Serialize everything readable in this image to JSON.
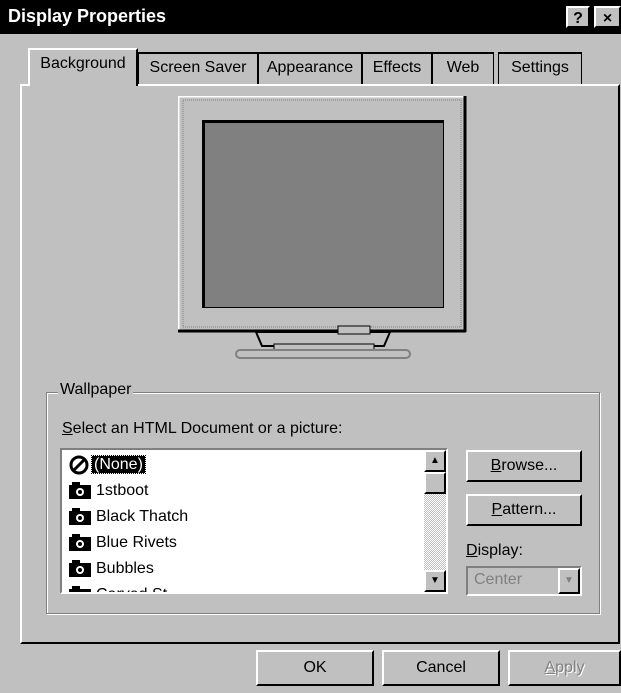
{
  "window": {
    "title": "Display Properties",
    "help_label": "?",
    "close_label": "×"
  },
  "tabs": [
    {
      "label": "Background",
      "active": true
    },
    {
      "label": "Screen Saver"
    },
    {
      "label": "Appearance"
    },
    {
      "label": "Effects"
    },
    {
      "label": "Web"
    },
    {
      "label": "Settings"
    }
  ],
  "wallpaper": {
    "group_label": "Wallpaper",
    "select_label_prefix": "S",
    "select_label_rest": "elect an HTML Document or a picture:",
    "items": [
      {
        "label": "(None)",
        "icon": "none-icon",
        "selected": true
      },
      {
        "label": "1stboot",
        "icon": "picture-icon"
      },
      {
        "label": "Black Thatch",
        "icon": "picture-icon"
      },
      {
        "label": "Blue Rivets",
        "icon": "picture-icon"
      },
      {
        "label": "Bubbles",
        "icon": "picture-icon"
      },
      {
        "label": "Carved St...",
        "icon": "picture-icon"
      }
    ],
    "browse_prefix": "B",
    "browse_rest": "rowse...",
    "pattern_prefix": "P",
    "pattern_rest": "attern...",
    "display_prefix": "D",
    "display_rest": "isplay:",
    "display_value": "Center"
  },
  "buttons": {
    "ok": "OK",
    "cancel": "Cancel",
    "apply_prefix": "A",
    "apply_rest": "pply"
  }
}
